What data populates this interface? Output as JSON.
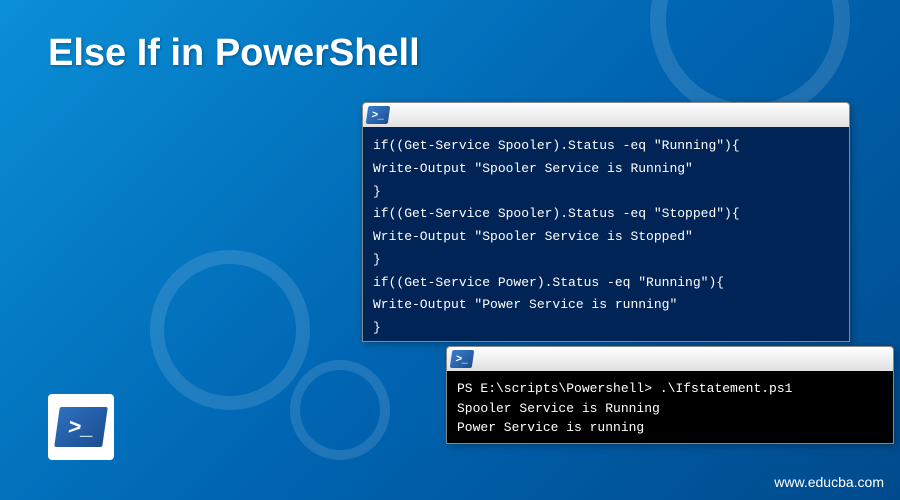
{
  "page": {
    "title": "Else If in PowerShell",
    "website": "www.educba.com"
  },
  "console1": {
    "lines": [
      "if((Get-Service Spooler).Status -eq \"Running\"){",
      "Write-Output \"Spooler Service is Running\"",
      "}",
      "if((Get-Service Spooler).Status -eq \"Stopped\"){",
      "Write-Output \"Spooler Service is Stopped\"",
      "}",
      "if((Get-Service Power).Status -eq \"Running\"){",
      "Write-Output \"Power Service is running\"",
      "}"
    ]
  },
  "console2": {
    "lines": [
      "PS E:\\scripts\\Powershell> .\\Ifstatement.ps1",
      "Spooler Service is Running",
      "Power Service is running"
    ]
  },
  "icons": {
    "ps_prompt": ">_"
  }
}
